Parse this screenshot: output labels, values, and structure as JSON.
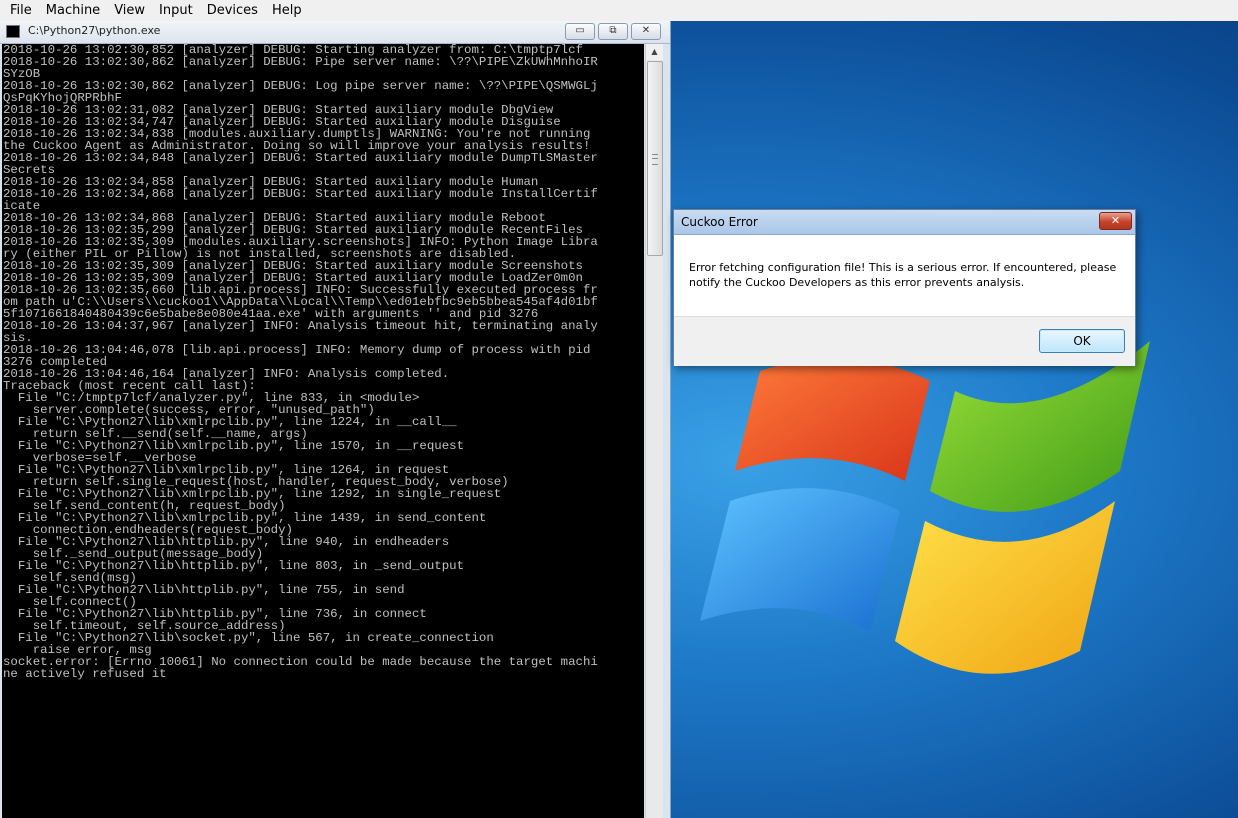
{
  "host_menu": {
    "items": [
      "File",
      "Machine",
      "View",
      "Input",
      "Devices",
      "Help"
    ]
  },
  "console": {
    "title": "C:\\Python27\\python.exe",
    "buttons": {
      "minimize": "▭",
      "restore": "⧉",
      "close": "✕"
    },
    "lines": [
      "2018-10-26 13:02:30,852 [analyzer] DEBUG: Starting analyzer from: C:\\tmptp7lcf",
      "2018-10-26 13:02:30,862 [analyzer] DEBUG: Pipe server name: \\??\\PIPE\\ZkUWhMnhoIR",
      "SYzOB",
      "2018-10-26 13:02:30,862 [analyzer] DEBUG: Log pipe server name: \\??\\PIPE\\QSMWGLj",
      "QsPqKYhojQRPRbhF",
      "2018-10-26 13:02:31,082 [analyzer] DEBUG: Started auxiliary module DbgView",
      "2018-10-26 13:02:34,747 [analyzer] DEBUG: Started auxiliary module Disguise",
      "2018-10-26 13:02:34,838 [modules.auxiliary.dumptls] WARNING: You're not running",
      "the Cuckoo Agent as Administrator. Doing so will improve your analysis results!",
      "2018-10-26 13:02:34,848 [analyzer] DEBUG: Started auxiliary module DumpTLSMaster",
      "Secrets",
      "2018-10-26 13:02:34,858 [analyzer] DEBUG: Started auxiliary module Human",
      "2018-10-26 13:02:34,868 [analyzer] DEBUG: Started auxiliary module InstallCertif",
      "icate",
      "2018-10-26 13:02:34,868 [analyzer] DEBUG: Started auxiliary module Reboot",
      "2018-10-26 13:02:35,299 [analyzer] DEBUG: Started auxiliary module RecentFiles",
      "2018-10-26 13:02:35,309 [modules.auxiliary.screenshots] INFO: Python Image Libra",
      "ry (either PIL or Pillow) is not installed, screenshots are disabled.",
      "2018-10-26 13:02:35,309 [analyzer] DEBUG: Started auxiliary module Screenshots",
      "2018-10-26 13:02:35,309 [analyzer] DEBUG: Started auxiliary module LoadZer0m0n",
      "2018-10-26 13:02:35,660 [lib.api.process] INFO: Successfully executed process fr",
      "om path u'C:\\\\Users\\\\cuckoo1\\\\AppData\\\\Local\\\\Temp\\\\ed01ebfbc9eb5bbea545af4d01bf",
      "5f1071661840480439c6e5babe8e080e41aa.exe' with arguments '' and pid 3276",
      "2018-10-26 13:04:37,967 [analyzer] INFO: Analysis timeout hit, terminating analy",
      "sis.",
      "2018-10-26 13:04:46,078 [lib.api.process] INFO: Memory dump of process with pid",
      "3276 completed",
      "2018-10-26 13:04:46,164 [analyzer] INFO: Analysis completed.",
      "Traceback (most recent call last):",
      "  File \"C:/tmptp7lcf/analyzer.py\", line 833, in <module>",
      "    server.complete(success, error, \"unused_path\")",
      "  File \"C:\\Python27\\lib\\xmlrpclib.py\", line 1224, in __call__",
      "    return self.__send(self.__name, args)",
      "  File \"C:\\Python27\\lib\\xmlrpclib.py\", line 1570, in __request",
      "    verbose=self.__verbose",
      "  File \"C:\\Python27\\lib\\xmlrpclib.py\", line 1264, in request",
      "    return self.single_request(host, handler, request_body, verbose)",
      "  File \"C:\\Python27\\lib\\xmlrpclib.py\", line 1292, in single_request",
      "    self.send_content(h, request_body)",
      "  File \"C:\\Python27\\lib\\xmlrpclib.py\", line 1439, in send_content",
      "    connection.endheaders(request_body)",
      "  File \"C:\\Python27\\lib\\httplib.py\", line 940, in endheaders",
      "    self._send_output(message_body)",
      "  File \"C:\\Python27\\lib\\httplib.py\", line 803, in _send_output",
      "    self.send(msg)",
      "  File \"C:\\Python27\\lib\\httplib.py\", line 755, in send",
      "    self.connect()",
      "  File \"C:\\Python27\\lib\\httplib.py\", line 736, in connect",
      "    self.timeout, self.source_address)",
      "  File \"C:\\Python27\\lib\\socket.py\", line 567, in create_connection",
      "    raise error, msg",
      "socket.error: [Errno 10061] No connection could be made because the target machi",
      "ne actively refused it"
    ]
  },
  "dialog": {
    "title": "Cuckoo Error",
    "close_glyph": "✕",
    "message_line1": "Error fetching configuration file! This is a serious error. If encountered, please",
    "message_line2": "notify the Cuckoo Developers as this error prevents analysis.",
    "ok_label": "OK"
  },
  "colors": {
    "console_bg": "#000000",
    "console_text": "#c0c0c0",
    "desktop_blue": "#1d78c7",
    "close_red": "#c7432b"
  }
}
